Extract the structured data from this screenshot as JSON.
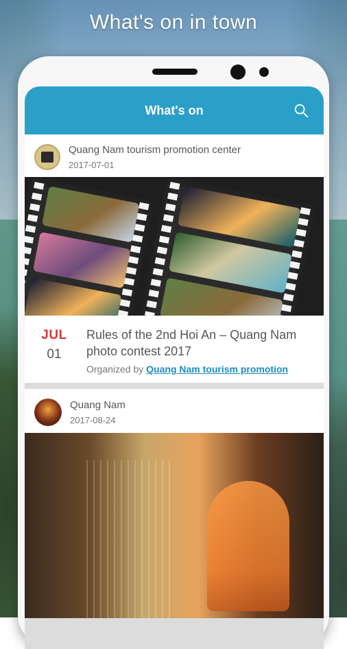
{
  "headline": "What's on in town",
  "app": {
    "title": "What's on",
    "search_icon": "search-icon"
  },
  "feed": {
    "cards": [
      {
        "poster": "Quang Nam tourism promotion center",
        "date": "2017-07-01",
        "event": {
          "month": "JUL",
          "day": "01",
          "title": "Rules of the 2nd Hoi An – Quang Nam photo contest 2017",
          "organized_by_label": "Organized by",
          "organizer_link": "Quang Nam tourism promotion"
        }
      },
      {
        "poster": "Quang Nam",
        "date": "2017-08-24"
      }
    ]
  },
  "colors": {
    "appbar": "#2aa0c9",
    "month": "#d23a3a",
    "link": "#1f8cc0"
  }
}
